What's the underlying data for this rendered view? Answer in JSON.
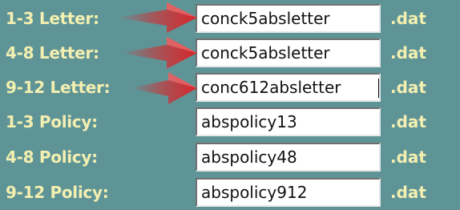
{
  "rows": [
    {
      "label": "1-3 Letter:",
      "value": "conck5absletter",
      "ext": ".dat"
    },
    {
      "label": "4-8 Letter:",
      "value": "conck5absletter",
      "ext": ".dat"
    },
    {
      "label": "9-12 Letter:",
      "value": "conc612absletter",
      "ext": ".dat"
    },
    {
      "label": "1-3 Policy:",
      "value": "abspolicy13",
      "ext": ".dat"
    },
    {
      "label": "4-8 Policy:",
      "value": "abspolicy48",
      "ext": ".dat"
    },
    {
      "label": "9-12 Policy:",
      "value": "abspolicy912",
      "ext": ".dat"
    }
  ],
  "colors": {
    "panel_background": "#5f9497",
    "label_text": "#f3efb0",
    "arrow": "#d8262a"
  },
  "icons": [
    "red-arrow-icon",
    "red-arrow-icon",
    "red-arrow-icon"
  ]
}
